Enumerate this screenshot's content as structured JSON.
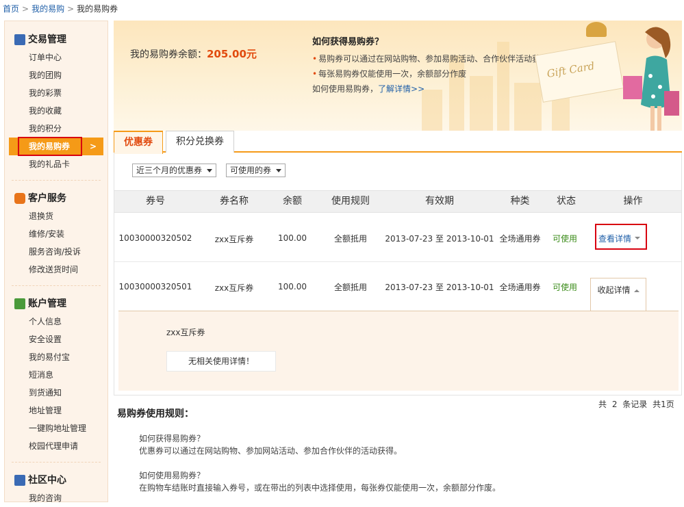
{
  "breadcrumb": {
    "home": "首页",
    "my_yigou": "我的易购",
    "current": "我的易购券"
  },
  "sidebar": {
    "sections": [
      {
        "title": "交易管理",
        "items": [
          "订单中心",
          "我的团购",
          "我的彩票",
          "我的收藏",
          "我的积分",
          "我的易购券",
          "我的礼品卡"
        ]
      },
      {
        "title": "客户服务",
        "items": [
          "退换货",
          "维修/安装",
          "服务咨询/投诉",
          "修改送货时间"
        ]
      },
      {
        "title": "账户管理",
        "items": [
          "个人信息",
          "安全设置",
          "我的易付宝",
          "短消息",
          "到货通知",
          "地址管理",
          "一键购地址管理",
          "校园代理申请"
        ]
      },
      {
        "title": "社区中心",
        "items": [
          "我的咨询"
        ]
      }
    ],
    "active_item": "我的易购券",
    "active_chevron": ">",
    "icon_colors": [
      "#3a6ab4",
      "#e8741a",
      "#4a9a3a",
      "#3a6ab4"
    ]
  },
  "banner": {
    "balance_label": "我的易购券余额：",
    "balance_value": "205.00元",
    "how_title": "如何获得易购券？",
    "how_lines": [
      "易购券可以通过在网站购物、参加易购活动、合作伙伴活动获得",
      "每张易购券仅能使用一次，余额部分作废"
    ],
    "how_use_prefix": "如何使用易购券，",
    "how_use_link": "了解详情>>",
    "card_text": "Gift Card"
  },
  "tabs": [
    {
      "label": "优惠券",
      "active": true
    },
    {
      "label": "积分兑换券",
      "active": false
    }
  ],
  "filters": {
    "period": "近三个月的优惠券",
    "status": "可使用的券"
  },
  "table": {
    "headers": [
      "券号",
      "券名称",
      "余额",
      "使用规则",
      "有效期",
      "种类",
      "状态",
      "操作"
    ],
    "rows": [
      {
        "code": "10030000320502",
        "name": "zxx互斥券",
        "balance": "100.00",
        "rule": "全额抵用",
        "start": "2013-07-23",
        "to": "至",
        "end": "2013-10-01",
        "kind": "全场通用券",
        "status": "可使用",
        "action": "查看详情"
      },
      {
        "code": "10030000320501",
        "name": "zxx互斥券",
        "balance": "100.00",
        "rule": "全额抵用",
        "start": "2013-07-23",
        "to": "至",
        "end": "2013-10-01",
        "kind": "全场通用券",
        "status": "可使用",
        "action": "收起详情"
      }
    ],
    "expanded": {
      "name": "zxx互斥券",
      "message": "无相关使用详情！"
    }
  },
  "pager": {
    "text": "共 2 条记录 共1页"
  },
  "rules": {
    "title": "易购券使用规则：",
    "lines": [
      "如何获得易购券？",
      "优惠券可以通过在网站购物、参加网站活动、参加合作伙伴的活动获得。",
      "",
      "如何使用易购券？",
      "在购物车结账时直接输入券号，或在带出的列表中选择使用，每张券仅能使用一次，余额部分作废。"
    ]
  }
}
